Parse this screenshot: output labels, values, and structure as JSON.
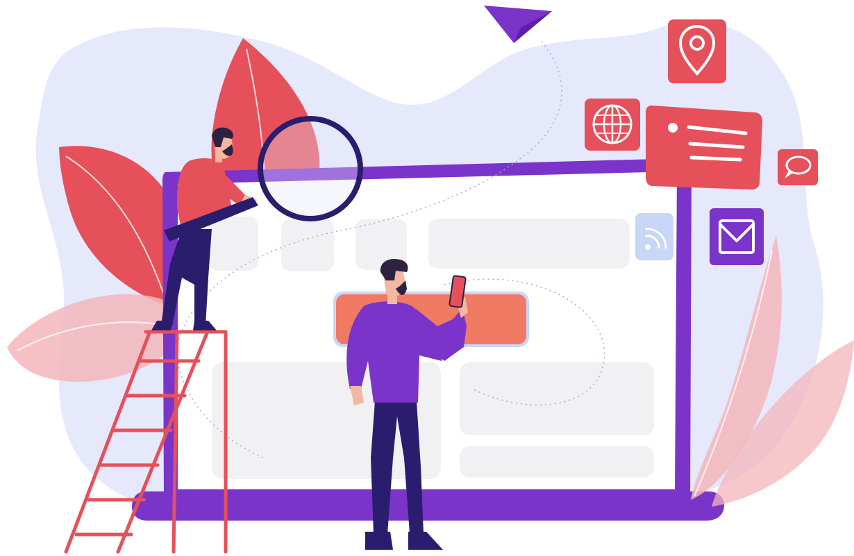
{
  "colors": {
    "background": "#ffffff",
    "blob": "#e6e8fb",
    "accent_red": "#e5505a",
    "accent_purple": "#7b34c9",
    "dark_navy": "#2a1d6e",
    "skin": "#f2b8a2",
    "hair": "#2d2340",
    "screen_white": "#ffffff",
    "placeholder_gray": "#f1f1f3",
    "orange_bar": "#f07a63",
    "wifi_tile": "#c8d6f7",
    "pale_pink_leaf": "#f3b6bb"
  },
  "icons": {
    "map_pin": "map-pin-icon",
    "globe": "globe-icon",
    "message_card": "message-card-icon",
    "chat_bubble": "chat-bubble-icon",
    "email": "email-icon",
    "wifi": "wifi-icon",
    "paper_plane": "paper-plane-icon",
    "magnifying_glass": "magnifying-glass-icon",
    "phone": "phone-icon"
  }
}
